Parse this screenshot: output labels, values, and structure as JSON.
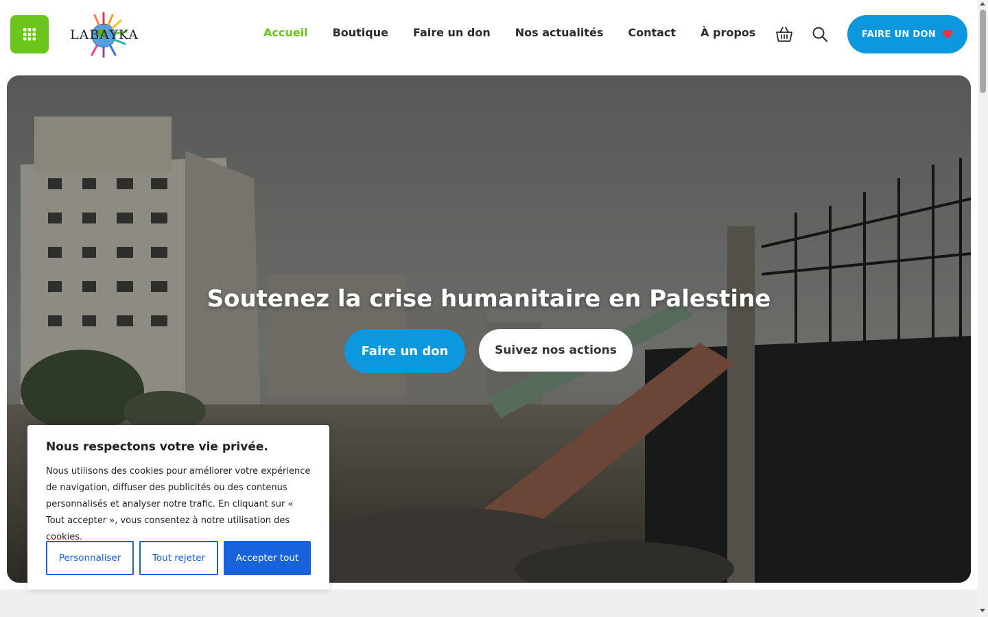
{
  "brand": {
    "logo_text": "LABAYKA"
  },
  "header": {
    "nav": [
      {
        "label": "Accueil",
        "active": true
      },
      {
        "label": "Boutique",
        "active": false
      },
      {
        "label": "Faire un don",
        "active": false
      },
      {
        "label": "Nos actualités",
        "active": false
      },
      {
        "label": "Contact",
        "active": false
      },
      {
        "label": "À propos",
        "active": false
      }
    ],
    "icons": [
      "grid-menu-icon",
      "cart-icon",
      "search-icon",
      "heart-icon"
    ],
    "donate_button": "FAIRE UN DON"
  },
  "hero": {
    "title": "Soutenez la crise humanitaire en Palestine",
    "primary_button": "Faire un don",
    "secondary_button": "Suivez nos actions",
    "image_description": "Damaged buildings and rubble under an overcast sky"
  },
  "cookie_banner": {
    "title": "Nous respectons votre vie privée.",
    "text": "Nous utilisons des cookies pour améliorer votre expérience de navigation, diffuser des publicités ou des contenus personnalisés et analyser notre trafic. En cliquant sur « Tout accepter », vous consentez à notre utilisation des cookies.",
    "buttons": {
      "customize": "Personnaliser",
      "reject": "Tout rejeter",
      "accept": "Accepter tout"
    }
  },
  "colors": {
    "accent_green": "#6bc51a",
    "primary_blue": "#0d97dc",
    "cookie_blue": "#1863dc",
    "heart_red": "#e8343f"
  }
}
